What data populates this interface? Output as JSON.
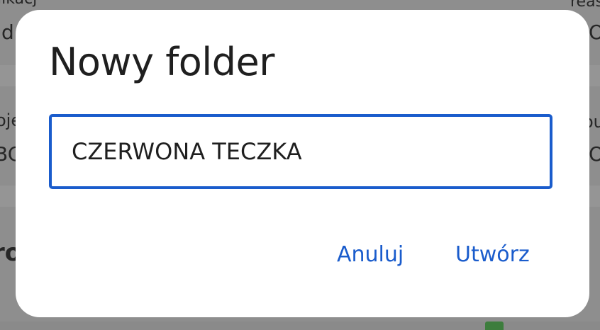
{
  "background": {
    "fragments": [
      {
        "name": "bg-text-top-left-1",
        "text": "likacj"
      },
      {
        "name": "bg-text-top-left-2",
        "text": "d"
      },
      {
        "name": "bg-text-top-right-1",
        "text": "reas"
      },
      {
        "name": "bg-text-top-right-2",
        "text": "O"
      },
      {
        "name": "bg-text-mid-left-1",
        "text": "oje"
      },
      {
        "name": "bg-text-mid-left-2",
        "text": "BC"
      },
      {
        "name": "bg-text-mid-right-1",
        "text": "ou"
      },
      {
        "name": "bg-text-mid-right-2",
        "text": "O"
      },
      {
        "name": "bg-text-section-left",
        "text": "ro"
      }
    ]
  },
  "dialog": {
    "title": "Nowy folder",
    "input": {
      "value": "CZERWONA TECZKA",
      "placeholder": ""
    },
    "actions": {
      "cancel_label": "Anuluj",
      "create_label": "Utwórz"
    }
  },
  "colors": {
    "accent": "#1a5ccc",
    "title_text": "#1f1f1f",
    "dialog_bg": "#ffffff",
    "scrim": "#8e8e8e"
  }
}
